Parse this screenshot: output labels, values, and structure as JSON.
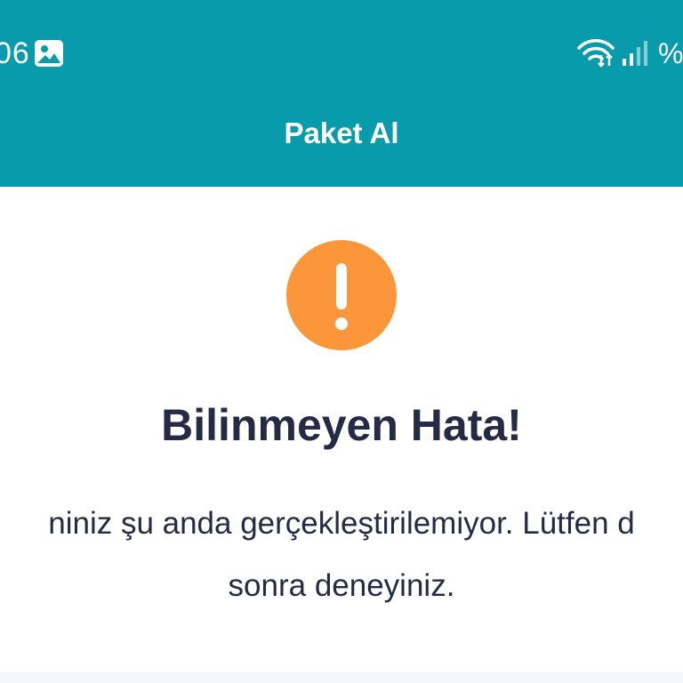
{
  "status_bar": {
    "time": "06",
    "battery": "%",
    "icons": [
      "image-icon",
      "wifi-icon",
      "signal-icon"
    ]
  },
  "app_bar": {
    "title": "Paket Al"
  },
  "error": {
    "icon": "exclamation-icon",
    "title": "Bilinmeyen Hata!",
    "message_line1": "niniz şu anda gerçekleştirilemiyor. Lütfen d",
    "message_line2": "sonra deneyiniz."
  },
  "colors": {
    "primary": "#079bab",
    "warning": "#fb963a",
    "text": "#252b44"
  }
}
